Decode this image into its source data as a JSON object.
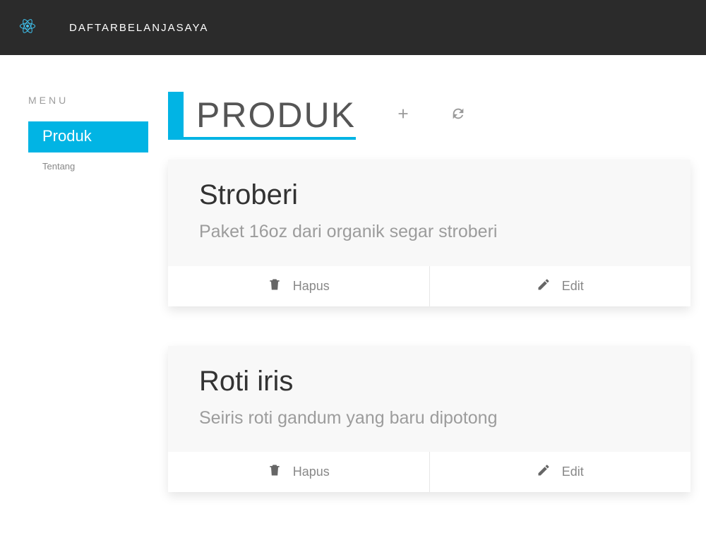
{
  "header": {
    "brand": "DAFTARBELANJASAYA"
  },
  "sidebar": {
    "label": "MENU",
    "items": [
      {
        "label": "Produk",
        "active": true
      },
      {
        "label": "Tentang",
        "active": false
      }
    ]
  },
  "page": {
    "header": "PRODUK"
  },
  "products": [
    {
      "name": "Stroberi",
      "desc": "Paket 16oz dari organik segar stroberi",
      "delete_label": "Hapus",
      "edit_label": "Edit"
    },
    {
      "name": "Roti iris",
      "desc": "Seiris roti gandum yang baru dipotong",
      "delete_label": "Hapus",
      "edit_label": "Edit"
    }
  ]
}
